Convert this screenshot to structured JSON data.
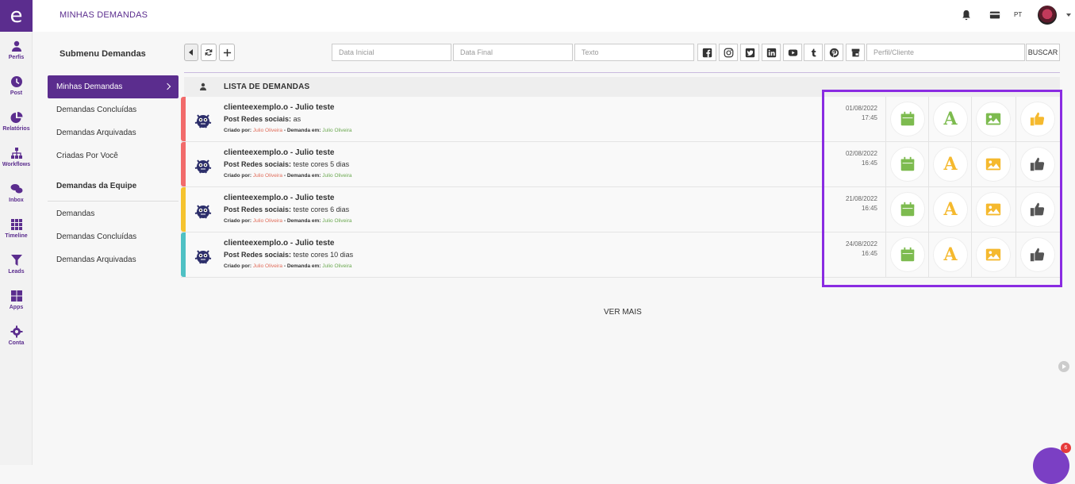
{
  "rail": {
    "logo": "e",
    "items": [
      {
        "label": "Perfis",
        "icon": "user-icon"
      },
      {
        "label": "Post",
        "icon": "clock-icon"
      },
      {
        "label": "Relatórios",
        "icon": "pie-chart-icon"
      },
      {
        "label": "Workflows",
        "icon": "sitemap-icon"
      },
      {
        "label": "Inbox",
        "icon": "chat-icon"
      },
      {
        "label": "Timeline",
        "icon": "grid-icon"
      },
      {
        "label": "Leads",
        "icon": "funnel-icon"
      },
      {
        "label": "Apps",
        "icon": "apps-icon"
      },
      {
        "label": "Conta",
        "icon": "gear-icon"
      }
    ]
  },
  "topbar": {
    "title": "MINHAS DEMANDAS",
    "lang": "PT"
  },
  "submenu": {
    "title": "Submenu Demandas",
    "items": [
      "Minhas Demandas",
      "Demandas Concluídas",
      "Demandas Arquivadas",
      "Criadas Por Você"
    ],
    "team_title": "Demandas da Equipe",
    "team_items": [
      "Demandas",
      "Demandas Concluídas",
      "Demandas Arquivadas"
    ]
  },
  "filters": {
    "data_inicial": "Data Inicial",
    "data_final": "Data Final",
    "texto": "Texto",
    "perfil": "Perfil/Cliente",
    "buscar": "BUSCAR"
  },
  "list": {
    "title": "LISTA DE DEMANDAS",
    "criado_label": "Criado por:",
    "demanda_label": "- Demanda em:",
    "post_label": "Post Redes sociais:",
    "rows": [
      {
        "client": "clienteexemplo.o - Julio teste",
        "post": "as",
        "criado": "Julio Oliveira",
        "demanda": "Julio Oliveira",
        "date": "01/08/2022",
        "time": "17:45",
        "color": "#f26b6b",
        "a_color": "#7dbb4f",
        "img_color": "#7dbb4f",
        "thumb_color": "#f5b92e"
      },
      {
        "client": "clienteexemplo.o - Julio teste",
        "post": "teste cores 5 dias",
        "criado": "Julio Oliveira",
        "demanda": "Julio Oliveira",
        "date": "02/08/2022",
        "time": "16:45",
        "color": "#f26b6b",
        "a_color": "#f5b92e",
        "img_color": "#f5b92e",
        "thumb_color": "#555555"
      },
      {
        "client": "clienteexemplo.o - Julio teste",
        "post": "teste cores 6 dias",
        "criado": "Julio Oliveira",
        "demanda": "Julio Oliveira",
        "date": "21/08/2022",
        "time": "16:45",
        "color": "#f5c32e",
        "a_color": "#f5b92e",
        "img_color": "#f5b92e",
        "thumb_color": "#555555"
      },
      {
        "client": "clienteexemplo.o - Julio teste",
        "post": "teste cores 10 dias",
        "criado": "Julio Oliveira",
        "demanda": "Julio Oliveira",
        "date": "24/08/2022",
        "time": "16:45",
        "color": "#4fc1c4",
        "a_color": "#f5b92e",
        "img_color": "#f5b92e",
        "thumb_color": "#555555"
      }
    ],
    "ver_mais": "VER MAIS"
  },
  "chat": {
    "badge": "6"
  },
  "colors": {
    "brand": "#5b2d8e",
    "calendar": "#7dbb4f",
    "highlight": "#8a2be2"
  }
}
